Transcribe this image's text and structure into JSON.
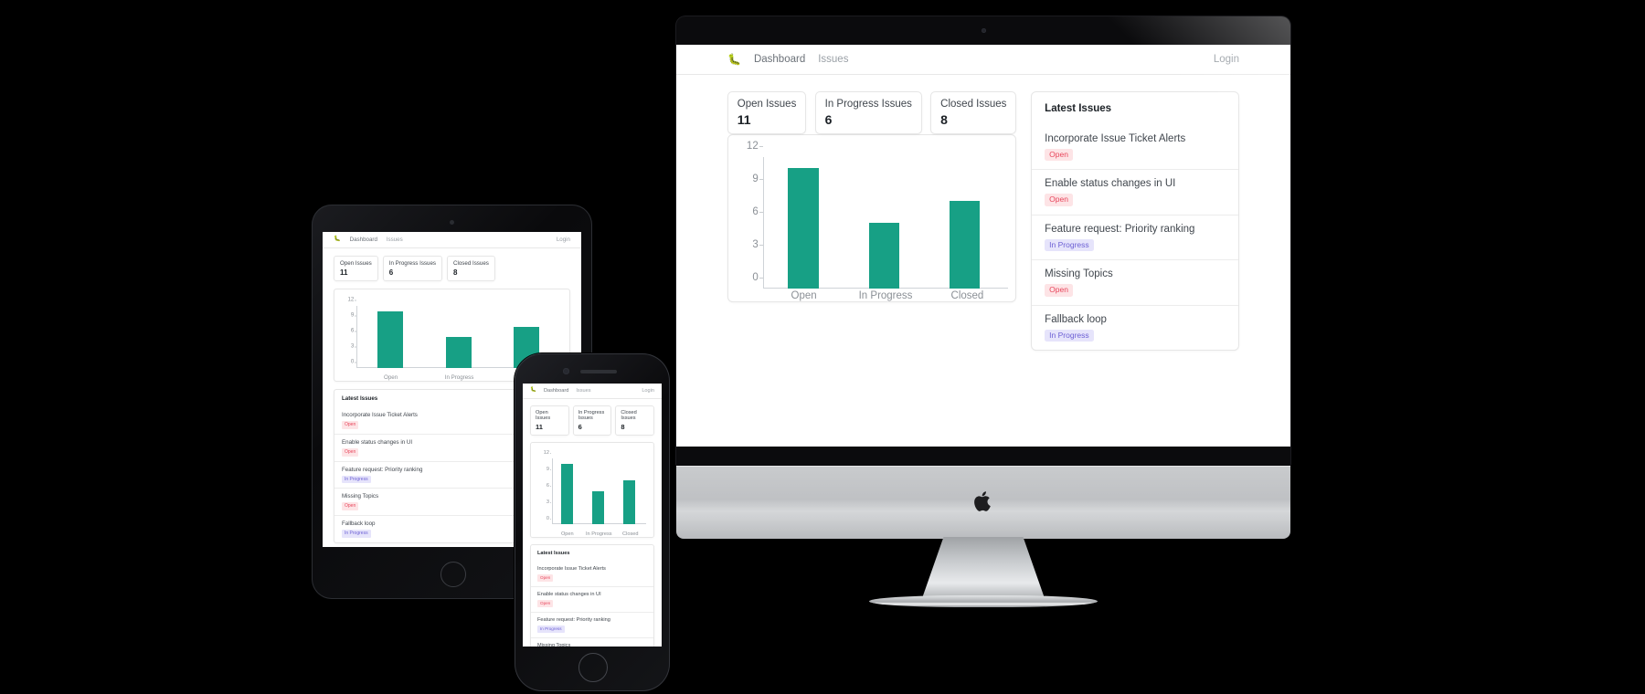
{
  "app": {
    "nav": {
      "brand_icon": "bug-icon",
      "links": [
        {
          "label": "Dashboard",
          "active": true
        },
        {
          "label": "Issues",
          "active": false
        }
      ],
      "login_label": "Login"
    },
    "stat_cards": [
      {
        "label": "Open Issues",
        "value": "11"
      },
      {
        "label": "In Progress Issues",
        "value": "6"
      },
      {
        "label": "Closed Issues",
        "value": "8"
      }
    ],
    "latest_issues": {
      "title": "Latest Issues",
      "items": [
        {
          "title": "Incorporate Issue Ticket Alerts",
          "status": "Open",
          "status_kind": "open"
        },
        {
          "title": "Enable status changes in UI",
          "status": "Open",
          "status_kind": "open"
        },
        {
          "title": "Feature request: Priority ranking",
          "status": "In Progress",
          "status_kind": "progress"
        },
        {
          "title": "Missing Topics",
          "status": "Open",
          "status_kind": "open"
        },
        {
          "title": "Fallback loop",
          "status": "In Progress",
          "status_kind": "progress"
        }
      ]
    }
  },
  "chart_data": {
    "type": "bar",
    "title": "",
    "xlabel": "",
    "ylabel": "",
    "categories": [
      "Open",
      "In Progress",
      "Closed"
    ],
    "values": [
      11,
      6,
      8
    ],
    "yticks": [
      0,
      3,
      6,
      9,
      12
    ],
    "ylim": [
      0,
      12
    ],
    "grid": false,
    "legend": false,
    "bar_color": "#17a085"
  },
  "colors": {
    "accent_teal": "#17a085",
    "badge_open_bg": "#fde4e6",
    "badge_open_fg": "#e8465c",
    "badge_progress_bg": "#e6e4fb",
    "badge_progress_fg": "#6c5fd4",
    "page_bg": "#000000"
  },
  "devices": [
    {
      "name": "desktop-imac"
    },
    {
      "name": "tablet-ipad"
    },
    {
      "name": "phone-iphone"
    }
  ]
}
